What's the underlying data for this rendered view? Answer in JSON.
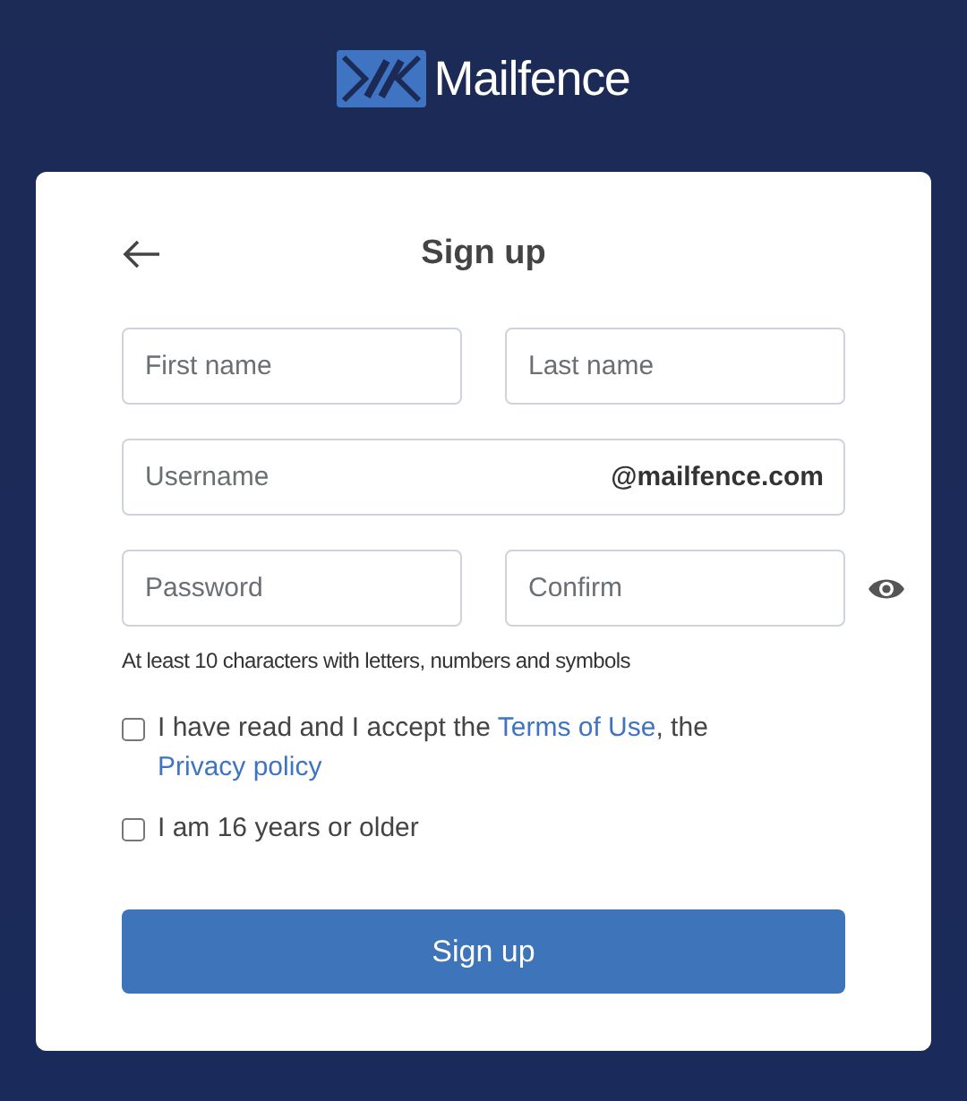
{
  "logo": {
    "text": "Mailfence"
  },
  "title": "Sign up",
  "name_fields": [
    {
      "placeholder": "First name"
    },
    {
      "placeholder": "Last name"
    }
  ],
  "username": {
    "placeholder": "Username",
    "suffix": "@mailfence.com"
  },
  "password_fields": [
    {
      "placeholder": "Password"
    },
    {
      "placeholder": "Confirm"
    }
  ],
  "password_hint": "At least 10 characters with letters, numbers and symbols",
  "checkboxes": [
    {
      "checked": false,
      "segments": [
        {
          "kind": "text",
          "text": "I have read and I accept the "
        },
        {
          "kind": "link",
          "text": "Terms of Use"
        },
        {
          "kind": "text",
          "text": ", the "
        },
        {
          "kind": "link",
          "text": "Privacy policy"
        }
      ]
    },
    {
      "checked": false,
      "segments": [
        {
          "kind": "text",
          "text": "I am 16 years or older"
        }
      ]
    }
  ],
  "submit": "Sign up"
}
